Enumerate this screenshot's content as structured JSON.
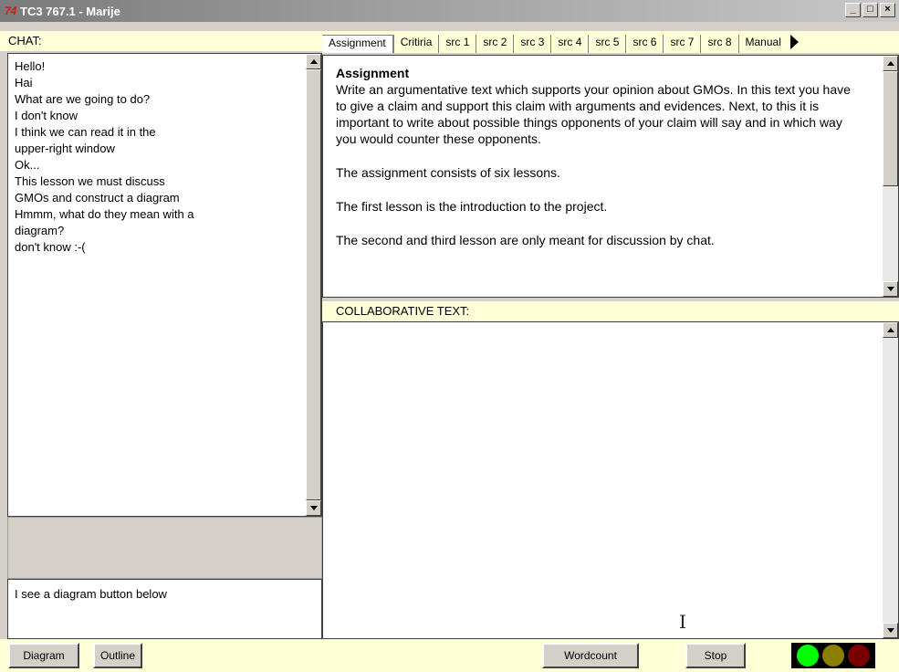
{
  "window": {
    "logo": "74",
    "title": "TC3 767.1 - Marije",
    "controls": [
      "_",
      "□",
      "×"
    ]
  },
  "chat": {
    "header": "CHAT:",
    "messages": [
      "Hello!",
      "Hai",
      "What are we going to do?",
      "I don't know",
      "I think we can read it in the",
      "upper-right window",
      "Ok...",
      "This lesson we must discuss",
      "GMOs and construct a diagram",
      "Hmmm, what do they mean with a",
      "diagram?",
      "don't know :-("
    ],
    "input_value": "I see a diagram button below"
  },
  "tabs": [
    "Assignment",
    "Critiria",
    "src 1",
    "src 2",
    "src 3",
    "src 4",
    "src 5",
    "src 6",
    "src 7",
    "src 8",
    "Manual"
  ],
  "assignment": {
    "heading": "Assignment",
    "paragraphs": [
      "Write an argumentative text which supports your opinion about GMOs. In this text you have to give a claim and support this claim with arguments and evidences. Next, to this it is important to write about possible things opponents of your claim will say and in which way you would counter these opponents.",
      "The assignment consists of six lessons.",
      "The first lesson is the introduction to the project.",
      "The second and third lesson are only meant for discussion by chat."
    ]
  },
  "collab": {
    "header": "COLLABORATIVE TEXT:"
  },
  "buttons": {
    "diagram": "Diagram",
    "outline": "Outline",
    "wordcount": "Wordcount",
    "stop": "Stop"
  },
  "traffic_light": {
    "green": "#00ff00",
    "yellow": "#8a8000",
    "red": "#7a0000"
  }
}
